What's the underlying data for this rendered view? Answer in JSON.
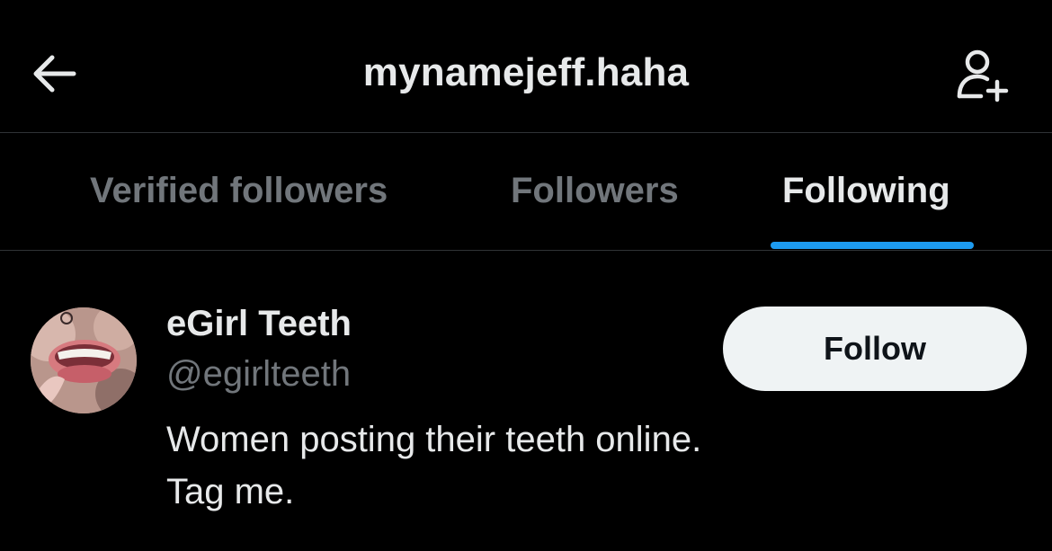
{
  "header": {
    "title": "mynamejeff.haha",
    "back_icon": "arrow-left-icon",
    "add_user_icon": "person-plus-icon"
  },
  "tabs": [
    {
      "label": "Verified followers",
      "active": false
    },
    {
      "label": "Followers",
      "active": false
    },
    {
      "label": "Following",
      "active": true
    }
  ],
  "users": [
    {
      "display_name": "eGirl Teeth",
      "handle": "@egirlteeth",
      "bio_lines": [
        "Women posting their teeth online.",
        "Tag me."
      ],
      "follow_label": "Follow",
      "avatar_description_icon": "avatar-image"
    }
  ],
  "colors": {
    "background": "#000000",
    "primary_text": "#e7e9ea",
    "secondary_text": "#71767b",
    "accent": "#1d9bf0",
    "divider": "#2f3336",
    "button_bg": "#eff3f4",
    "button_text": "#0f1419"
  }
}
